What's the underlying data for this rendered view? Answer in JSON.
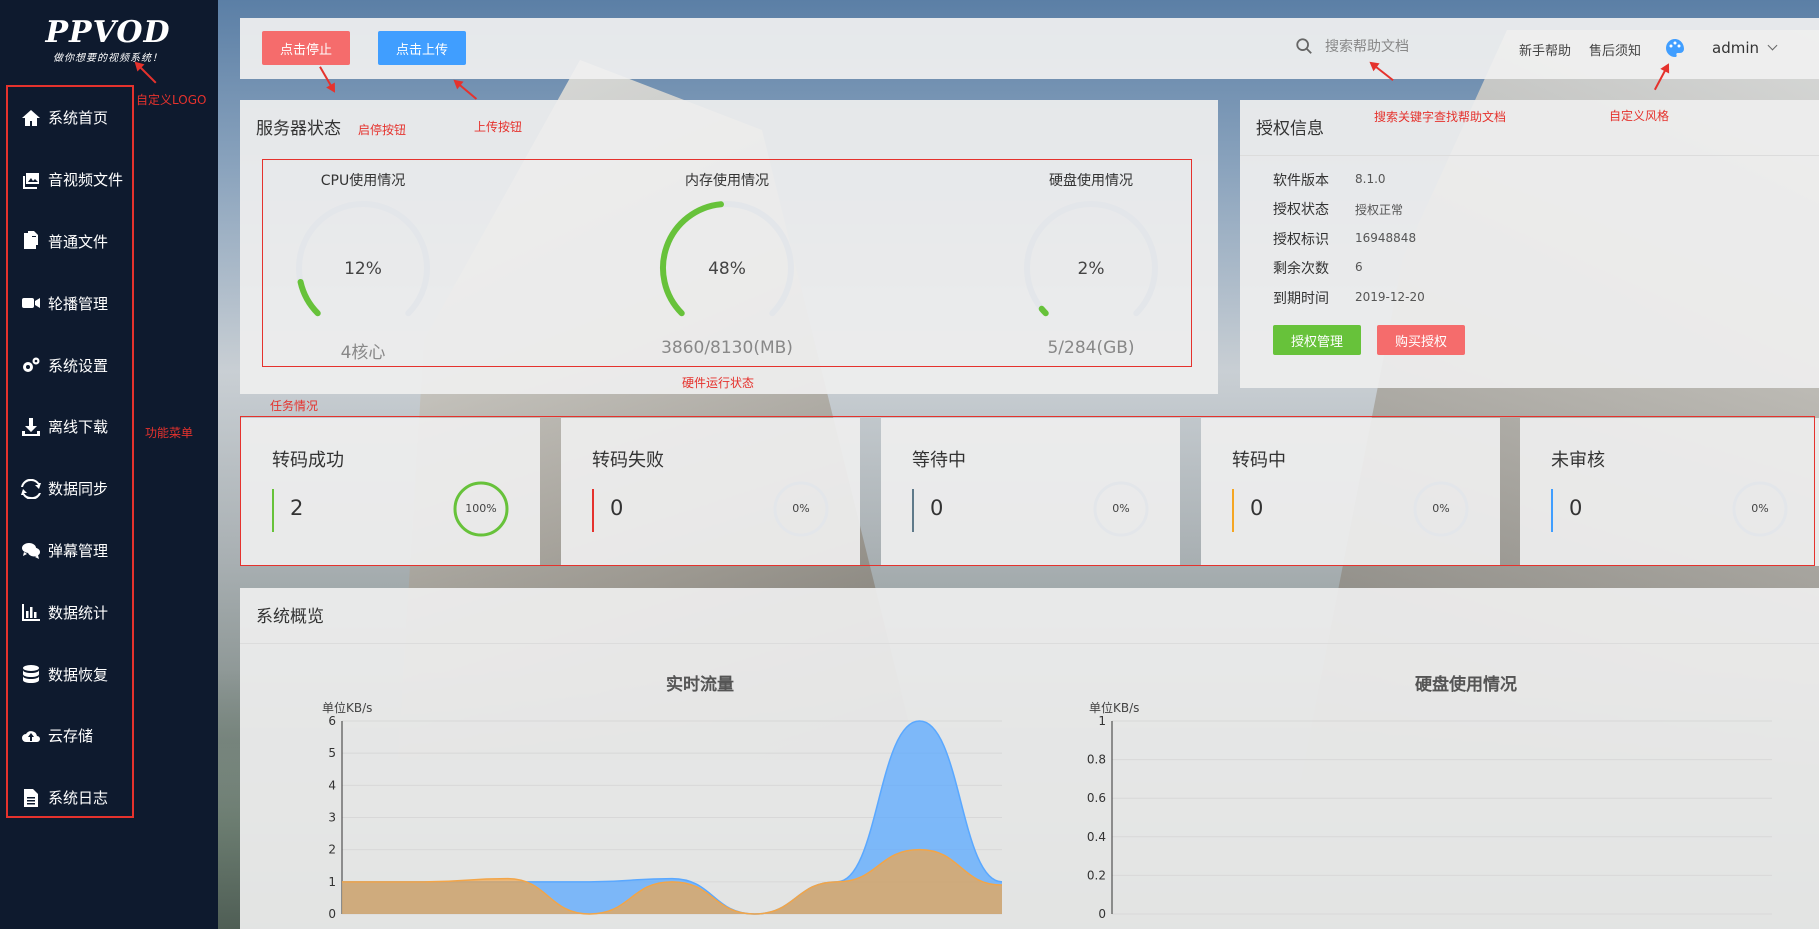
{
  "sidebar": {
    "logo": {
      "brand": "PPVOD",
      "slogan": "做你想要的视频系统！"
    },
    "items": [
      {
        "label": "系统首页",
        "icon": "home-icon"
      },
      {
        "label": "音视频文件",
        "icon": "media-files-icon"
      },
      {
        "label": "普通文件",
        "icon": "files-icon"
      },
      {
        "label": "轮播管理",
        "icon": "video-camera-icon"
      },
      {
        "label": "系统设置",
        "icon": "gears-icon"
      },
      {
        "label": "离线下载",
        "icon": "download-icon"
      },
      {
        "label": "数据同步",
        "icon": "sync-icon"
      },
      {
        "label": "弹幕管理",
        "icon": "chat-icon"
      },
      {
        "label": "数据统计",
        "icon": "bar-chart-icon"
      },
      {
        "label": "数据恢复",
        "icon": "database-icon"
      },
      {
        "label": "云存储",
        "icon": "cloud-upload-icon"
      },
      {
        "label": "系统日志",
        "icon": "log-file-icon"
      }
    ]
  },
  "annotations": {
    "logo": "自定义LOGO",
    "menu": "功能菜单",
    "stop_button": "启停按钮",
    "upload_button": "上传按钮",
    "search": "搜索关键字查找帮助文档",
    "theme": "自定义风格",
    "hardware": "硬件运行状态",
    "tasks": "任务情况"
  },
  "topbar": {
    "stop_label": "点击停止",
    "upload_label": "点击上传",
    "search_placeholder": "搜索帮助文档",
    "help_label": "新手帮助",
    "aftersale_label": "售后须知",
    "user": "admin"
  },
  "server_status": {
    "title": "服务器状态",
    "gauges": [
      {
        "title": "CPU使用情况",
        "value": "12%",
        "percent": 12,
        "sub": "4核心"
      },
      {
        "title": "内存使用情况",
        "value": "48%",
        "percent": 48,
        "sub": "3860/8130(MB)"
      },
      {
        "title": "硬盘使用情况",
        "value": "2%",
        "percent": 2,
        "sub": "5/284(GB)"
      }
    ]
  },
  "license": {
    "title": "授权信息",
    "rows": [
      {
        "label": "软件版本",
        "value": "8.1.0"
      },
      {
        "label": "授权状态",
        "value": "授权正常"
      },
      {
        "label": "授权标识",
        "value": "16948848"
      },
      {
        "label": "剩余次数",
        "value": "6"
      },
      {
        "label": "到期时间",
        "value": "2019-12-20"
      }
    ],
    "manage_label": "授权管理",
    "buy_label": "购买授权"
  },
  "tasks": [
    {
      "title": "转码成功",
      "value": "2",
      "percent_label": "100%",
      "percent": 100,
      "color": "#67c23a"
    },
    {
      "title": "转码失败",
      "value": "0",
      "percent_label": "0%",
      "percent": 0,
      "color": "#e5322d"
    },
    {
      "title": "等待中",
      "value": "0",
      "percent_label": "0%",
      "percent": 0,
      "color": "#5f7a8a"
    },
    {
      "title": "转码中",
      "value": "0",
      "percent_label": "0%",
      "percent": 0,
      "color": "#f5a623"
    },
    {
      "title": "未审核",
      "value": "0",
      "percent_label": "0%",
      "percent": 0,
      "color": "#409eff"
    }
  ],
  "overview": {
    "title": "系统概览"
  },
  "colors": {
    "success": "#67c23a",
    "danger": "#f56c6c",
    "primary": "#409eff",
    "sidebar": "#0e1a2e"
  },
  "chart_data": [
    {
      "type": "area",
      "title": "实时流量",
      "ylabel": "单位KB/s",
      "ylim": [
        0,
        6
      ],
      "yticks": [
        "0",
        "1",
        "2",
        "3",
        "4",
        "5",
        "6"
      ],
      "series": [
        {
          "color": "#5aa8ff",
          "x": [
            0,
            1,
            2,
            3,
            4,
            5,
            6,
            7,
            8
          ],
          "values": [
            1,
            1,
            1,
            1,
            1.1,
            0,
            1,
            6,
            1
          ]
        },
        {
          "color": "#f2a548",
          "x": [
            0,
            1,
            2,
            3,
            4,
            5,
            6,
            7,
            8
          ],
          "values": [
            1,
            1,
            1.1,
            0,
            1,
            0,
            1,
            2,
            0.9
          ]
        }
      ]
    },
    {
      "type": "area",
      "title": "硬盘使用情况",
      "ylabel": "单位KB/s",
      "ylim": [
        0,
        1
      ],
      "yticks": [
        "0",
        "0.2",
        "0.4",
        "0.6",
        "0.8",
        "1"
      ]
    }
  ]
}
